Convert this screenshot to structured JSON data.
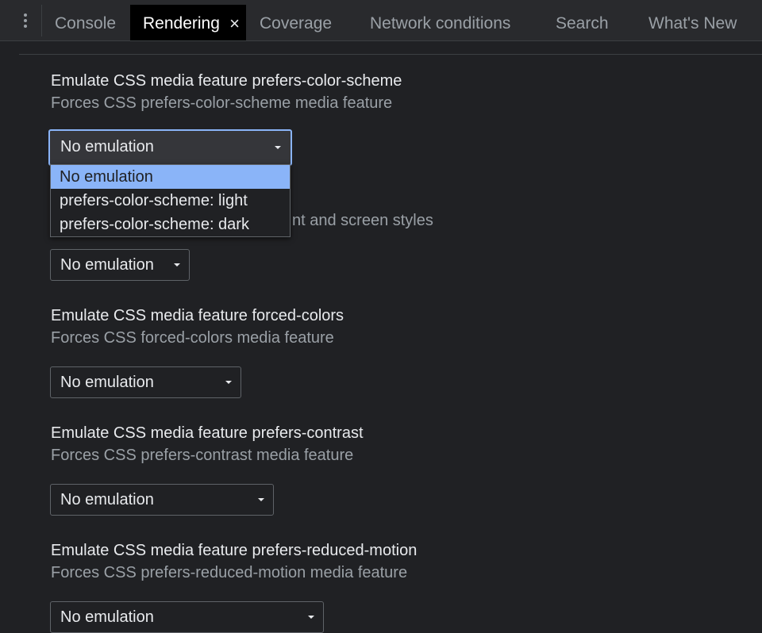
{
  "tabs": [
    {
      "label": "Console"
    },
    {
      "label": "Rendering",
      "close": "×"
    },
    {
      "label": "Coverage"
    },
    {
      "label": "Network conditions"
    },
    {
      "label": "Search"
    },
    {
      "label": "What's New"
    }
  ],
  "sections": [
    {
      "title": "Emulate CSS media feature prefers-color-scheme",
      "description": "Forces CSS prefers-color-scheme media feature",
      "value": "No emulation"
    },
    {
      "description_partial": "nt and screen styles",
      "value": "No emulation"
    },
    {
      "title": "Emulate CSS media feature forced-colors",
      "description": "Forces CSS forced-colors media feature",
      "value": "No emulation"
    },
    {
      "title": "Emulate CSS media feature prefers-contrast",
      "description": "Forces CSS prefers-contrast media feature",
      "value": "No emulation"
    },
    {
      "title": "Emulate CSS media feature prefers-reduced-motion",
      "description": "Forces CSS prefers-reduced-motion media feature",
      "value": "No emulation"
    }
  ],
  "dropdown": {
    "options": [
      "No emulation",
      "prefers-color-scheme: light",
      "prefers-color-scheme: dark"
    ],
    "selected_index": 0
  },
  "colors": {
    "background": "#202124",
    "tabbar": "#292a2d",
    "accent": "#8ab4f8",
    "text": "#e8eaed",
    "muted_text": "#9aa0a6"
  }
}
